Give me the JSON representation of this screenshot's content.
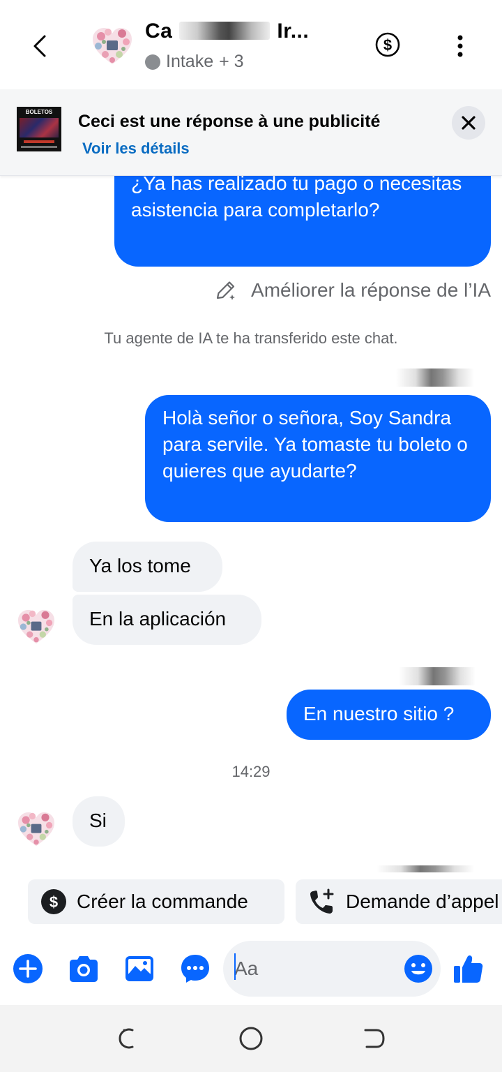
{
  "header": {
    "contact_name_start": "Ca",
    "contact_name_end": "Ir...",
    "labels": "Intake",
    "labels_extra": "+ 3",
    "icons": {
      "back": "back-arrow-icon",
      "payment": "dollar-circle-icon",
      "more": "more-vertical-icon"
    }
  },
  "ad_banner": {
    "thumbnail_text": "BOLETOS",
    "title": "Ceci est une réponse à une publicité",
    "details_link": "Voir les détails",
    "close_icon": "close-icon"
  },
  "thread": {
    "messages": [
      {
        "direction": "outgoing",
        "text": "¿Ya has realizado tu pago o necesitas asistencia para completarlo?"
      },
      {
        "direction": "outgoing",
        "text": "Holà señor o señora, Soy Sandra para servile. Ya tomaste tu boleto o quieres que ayudarte?"
      },
      {
        "direction": "incoming",
        "text": "Ya los tome"
      },
      {
        "direction": "incoming",
        "text": "En la aplicación"
      },
      {
        "direction": "outgoing",
        "text": "En nuestro sitio ?"
      },
      {
        "direction": "incoming",
        "text": "Si"
      }
    ],
    "improve_ai": "Améliorer la réponse de l’IA",
    "system_message": "Tu agente de IA te ha transferido este chat.",
    "timestamp": "14:29"
  },
  "quick_actions": [
    {
      "label": "Créer la commande",
      "icon": "dollar-circle-icon"
    },
    {
      "label": "Demande d’appel",
      "icon": "phone-add-icon"
    }
  ],
  "composer": {
    "placeholder": "Aa",
    "icons": [
      "add-icon",
      "camera-icon",
      "image-icon",
      "chat-bubble-icon",
      "emoji-icon",
      "thumbs-up-icon"
    ]
  },
  "colors": {
    "accent": "#0866ff",
    "link": "#0a6cc2",
    "incoming_bubble": "#f0f2f5",
    "secondary_text": "#65676b"
  }
}
